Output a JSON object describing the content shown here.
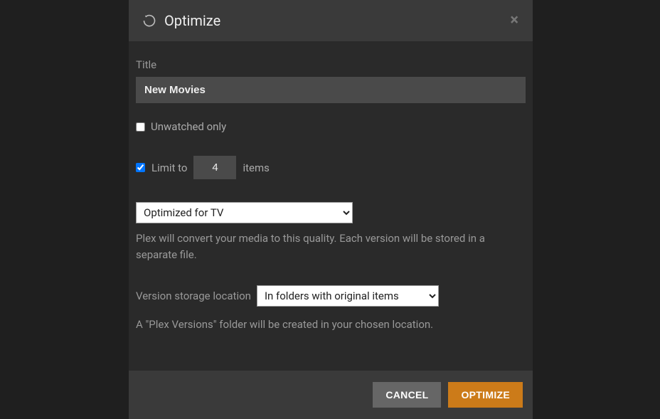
{
  "header": {
    "title": "Optimize"
  },
  "form": {
    "title_label": "Title",
    "title_value": "New Movies",
    "unwatched_label": "Unwatched only",
    "unwatched_checked": false,
    "limit_checked": true,
    "limit_label_prefix": "Limit to",
    "limit_value": "4",
    "limit_label_suffix": "items",
    "quality_selected": "Optimized for TV",
    "quality_help": "Plex will convert your media to this quality. Each version will be stored in a separate file.",
    "location_label": "Version storage location",
    "location_selected": "In folders with original items",
    "location_help": "A \"Plex Versions\" folder will be created in your chosen location."
  },
  "footer": {
    "cancel": "CANCEL",
    "optimize": "OPTIMIZE"
  }
}
